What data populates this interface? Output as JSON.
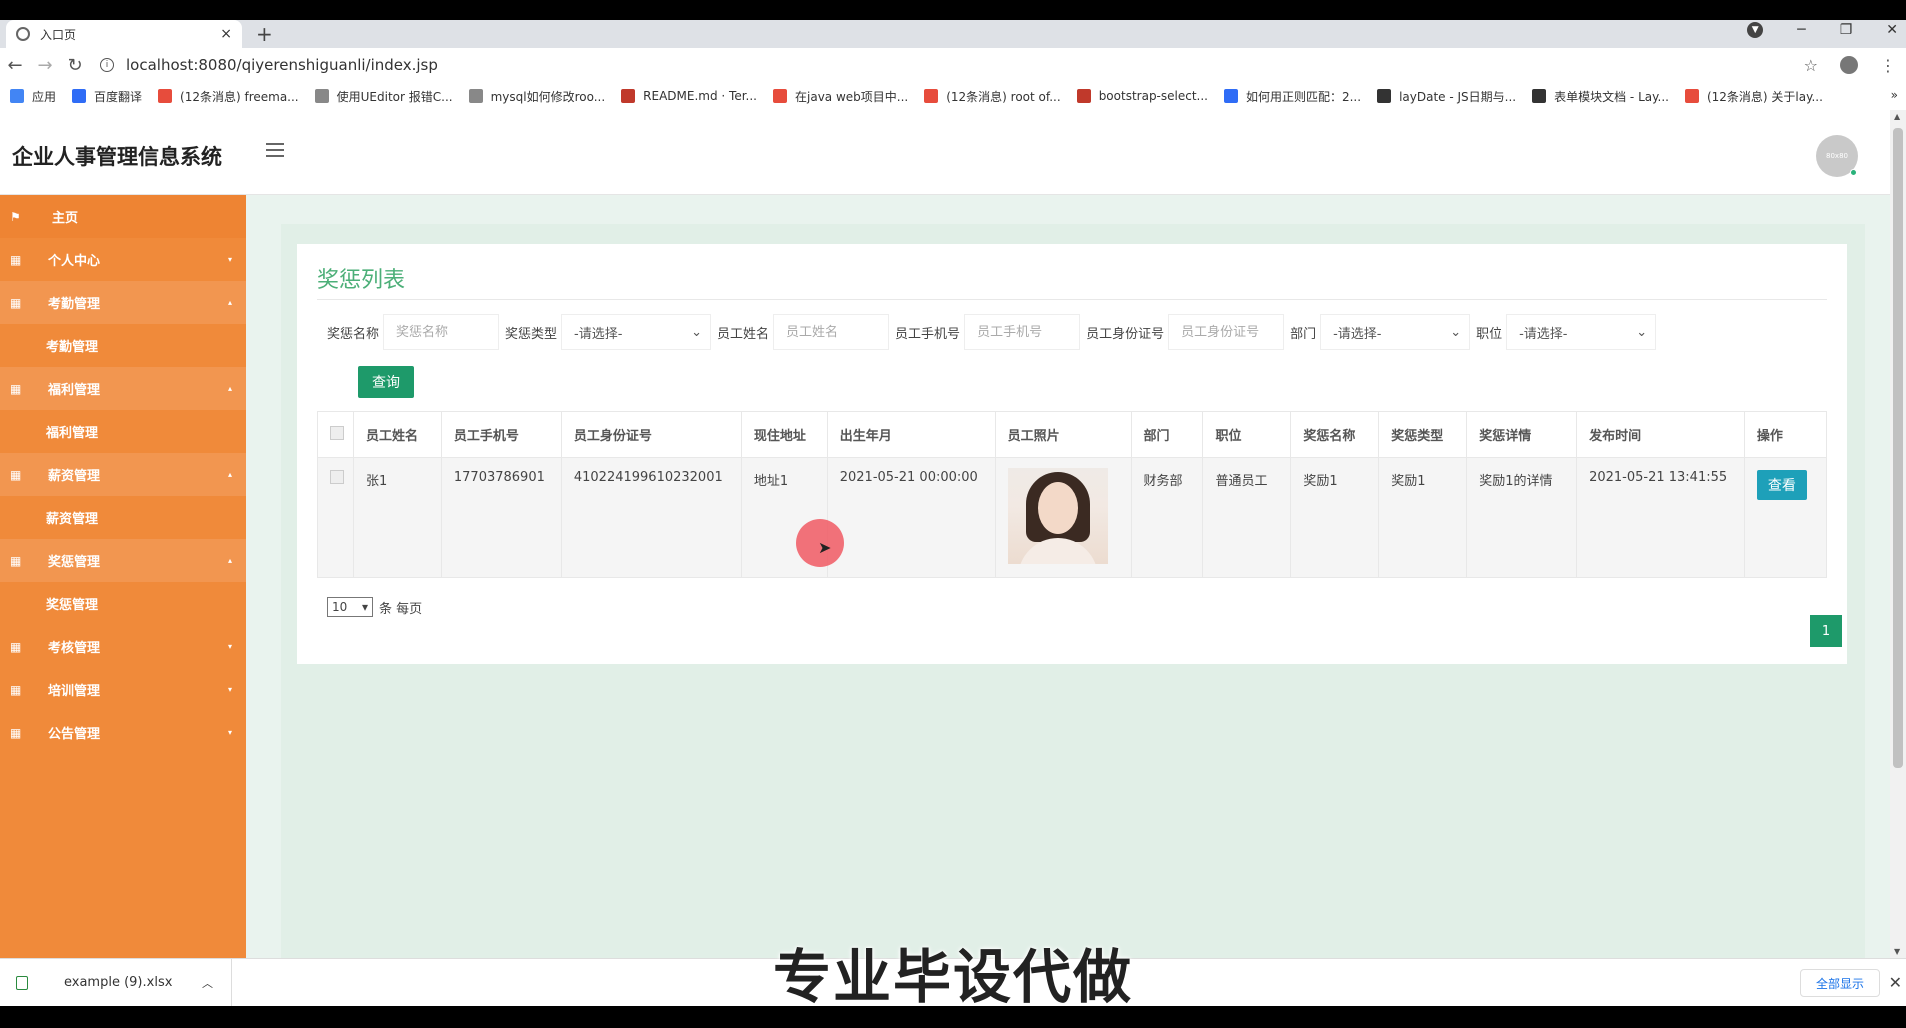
{
  "browser": {
    "tab_title": "入口页",
    "tab_close": "×",
    "new_tab": "+",
    "url": "localhost:8080/qiyerenshiguanli/index.jsp",
    "window_min": "─",
    "window_restore": "❐",
    "window_close": "✕",
    "bookmarks": [
      {
        "label": "应用",
        "color": "#4285f4"
      },
      {
        "label": "百度翻译",
        "color": "#2f6cf6"
      },
      {
        "label": "(12条消息) freema...",
        "color": "#e74c3c"
      },
      {
        "label": "使用UEditor 报错C...",
        "color": "#888888"
      },
      {
        "label": "mysql如何修改roo...",
        "color": "#888888"
      },
      {
        "label": "README.md · Ter...",
        "color": "#c0392b"
      },
      {
        "label": "在java web项目中...",
        "color": "#e74c3c"
      },
      {
        "label": "(12条消息) root of...",
        "color": "#e74c3c"
      },
      {
        "label": "bootstrap-select...",
        "color": "#c0392b"
      },
      {
        "label": "如何用正则匹配：2...",
        "color": "#2f6cf6"
      },
      {
        "label": "layDate - JS日期与...",
        "color": "#333333"
      },
      {
        "label": "表单模块文档 - Lay...",
        "color": "#333333"
      },
      {
        "label": "(12条消息) 关于lay...",
        "color": "#e74c3c"
      }
    ],
    "bookmarks_more": "»"
  },
  "header": {
    "app_title": "企业人事管理信息系统",
    "avatar_text": "80x80"
  },
  "sidebar": {
    "items": [
      {
        "label": "主页",
        "icon": "flag-icon",
        "type": "main"
      },
      {
        "label": "个人中心",
        "icon": "grid-icon",
        "type": "group",
        "caret": "▾"
      },
      {
        "label": "考勤管理",
        "icon": "grid-icon",
        "type": "group-open",
        "caret": "▴"
      },
      {
        "label": "考勤管理",
        "type": "sub"
      },
      {
        "label": "福利管理",
        "icon": "grid-icon",
        "type": "group-open",
        "caret": "▴"
      },
      {
        "label": "福利管理",
        "type": "sub"
      },
      {
        "label": "薪资管理",
        "icon": "grid-icon",
        "type": "group-open",
        "caret": "▴"
      },
      {
        "label": "薪资管理",
        "type": "sub"
      },
      {
        "label": "奖惩管理",
        "icon": "grid-icon",
        "type": "group-open",
        "caret": "▴"
      },
      {
        "label": "奖惩管理",
        "type": "sub"
      },
      {
        "label": "考核管理",
        "icon": "grid-icon",
        "type": "group",
        "caret": "▾"
      },
      {
        "label": "培训管理",
        "icon": "grid-icon",
        "type": "group",
        "caret": "▾"
      },
      {
        "label": "公告管理",
        "icon": "grid-icon",
        "type": "group",
        "caret": "▾"
      }
    ]
  },
  "panel": {
    "title": "奖惩列表",
    "filters": {
      "reward_name_label": "奖惩名称",
      "reward_name_placeholder": "奖惩名称",
      "reward_type_label": "奖惩类型",
      "reward_type_value": "-请选择-",
      "emp_name_label": "员工姓名",
      "emp_name_placeholder": "员工姓名",
      "emp_phone_label": "员工手机号",
      "emp_phone_placeholder": "员工手机号",
      "emp_id_label": "员工身份证号",
      "emp_id_placeholder": "员工身份证号",
      "dept_label": "部门",
      "dept_value": "-请选择-",
      "position_label": "职位",
      "position_value": "-请选择-"
    },
    "query_button": "查询",
    "table": {
      "headers": [
        "员工姓名",
        "员工手机号",
        "员工身份证号",
        "现住地址",
        "出生年月",
        "员工照片",
        "部门",
        "职位",
        "奖惩名称",
        "奖惩类型",
        "奖惩详情",
        "发布时间",
        "操作"
      ],
      "rows": [
        {
          "name": "张1",
          "phone": "17703786901",
          "id_card": "410224199610232001",
          "address": "地址1",
          "birth": "2021-05-21 00:00:00",
          "dept": "财务部",
          "position": "普通员工",
          "reward_name": "奖励1",
          "reward_type": "奖励1",
          "reward_detail": "奖励1的详情",
          "publish_time": "2021-05-21 13:41:55",
          "action": "查看"
        }
      ]
    },
    "page_size": "10",
    "per_page_text": "条 每页",
    "current_page": "1"
  },
  "caption": "专业毕设代做",
  "downloads": {
    "file_name": "example (9).xlsx",
    "show_all": "全部显示",
    "close": "✕"
  },
  "colors": {
    "sidebar": "#f08a3a",
    "accent_green": "#1e9a6a",
    "title_green": "#4caf78",
    "view_button": "#1ea0b9"
  }
}
